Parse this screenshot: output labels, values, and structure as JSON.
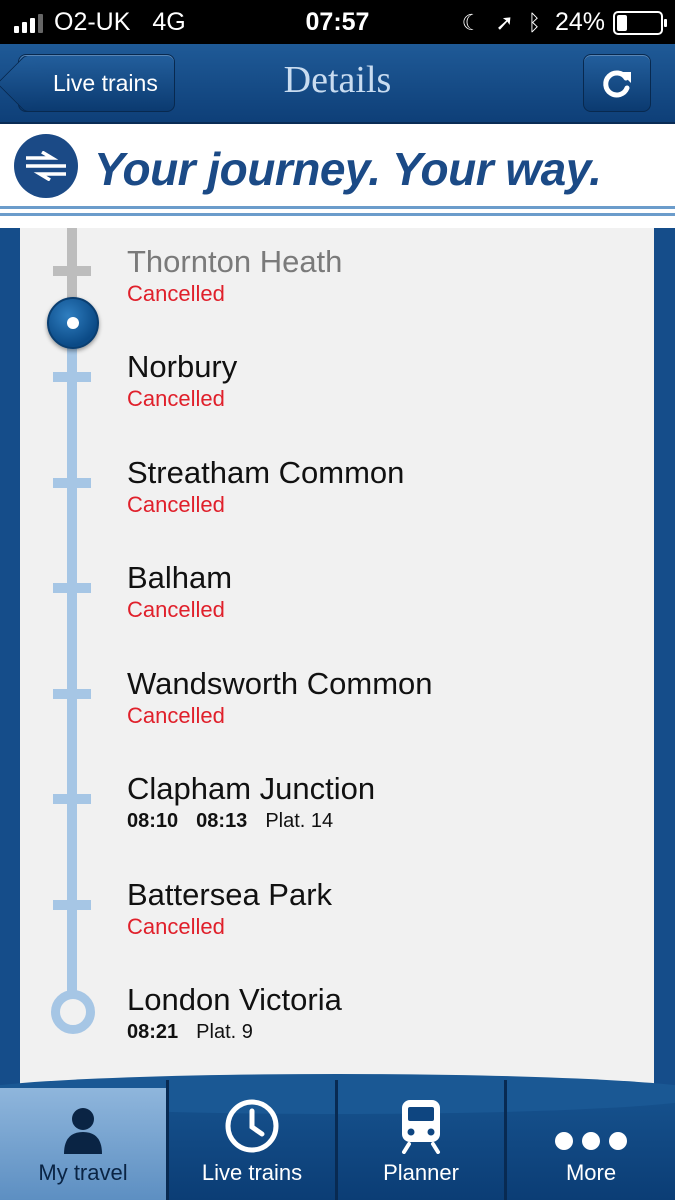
{
  "status_bar": {
    "carrier": "O2-UK",
    "network": "4G",
    "time": "07:57",
    "battery": "24%",
    "battery_level": 0.24
  },
  "nav": {
    "back_label": "Live trains",
    "title": "Details"
  },
  "banner": {
    "tagline": "Your journey. Your way."
  },
  "stops": [
    {
      "name": "Thornton Heath",
      "status": "Cancelled"
    },
    {
      "name": "Norbury",
      "status": "Cancelled"
    },
    {
      "name": "Streatham Common",
      "status": "Cancelled"
    },
    {
      "name": "Balham",
      "status": "Cancelled"
    },
    {
      "name": "Wandsworth Common",
      "status": "Cancelled"
    },
    {
      "name": "Clapham Junction",
      "scheduled": "08:10",
      "expected": "08:13",
      "platform": "Plat. 14"
    },
    {
      "name": "Battersea Park",
      "status": "Cancelled"
    },
    {
      "name": "London Victoria",
      "scheduled": "08:21",
      "platform": "Plat. 9"
    }
  ],
  "tabs": [
    {
      "label": "My travel",
      "icon": "person-icon",
      "active": true
    },
    {
      "label": "Live trains",
      "icon": "clock-icon"
    },
    {
      "label": "Planner",
      "icon": "train-icon"
    },
    {
      "label": "More",
      "icon": "more-dots-icon"
    }
  ],
  "colors": {
    "navy": "#154d8a",
    "cancelled_red": "#e0202b",
    "route_line": "#a6c6e5"
  }
}
